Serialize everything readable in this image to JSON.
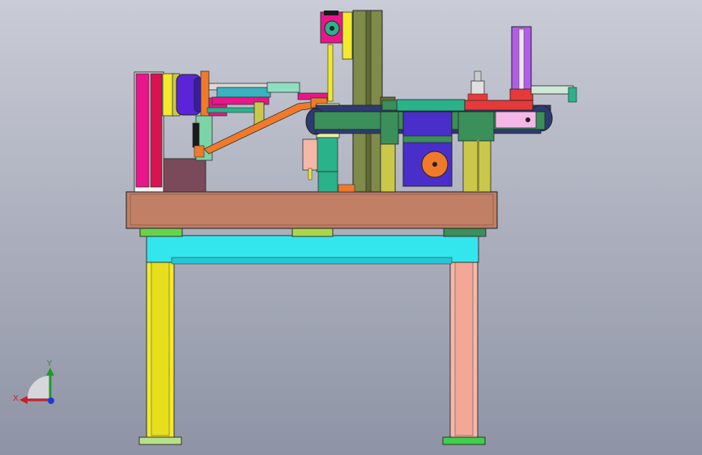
{
  "viewport": {
    "background_top": "#c9ccd6",
    "background_bottom": "#8e93a5"
  },
  "triad": {
    "x_label": "X",
    "y_label": "Y",
    "x_color": "#c8202a",
    "y_color": "#1f9a2a",
    "z_color": "#1e3ad6"
  },
  "model": {
    "colors": {
      "table_top": "#c17f66",
      "crossbar": "#33e6ee",
      "leg_left": "#f2ea2a",
      "leg_right": "#f5b7a8",
      "feet": "#66d44a",
      "column": "#7f8b4a",
      "motor_plate": "#4a2ec9",
      "gear": "#f07a2a",
      "magenta": "#e8168a",
      "purple": "#5a25d8",
      "orange_rail": "#f07a2a",
      "red_rail": "#e63a3a",
      "teal": "#2ab38a",
      "olive": "#c9c84a"
    }
  }
}
